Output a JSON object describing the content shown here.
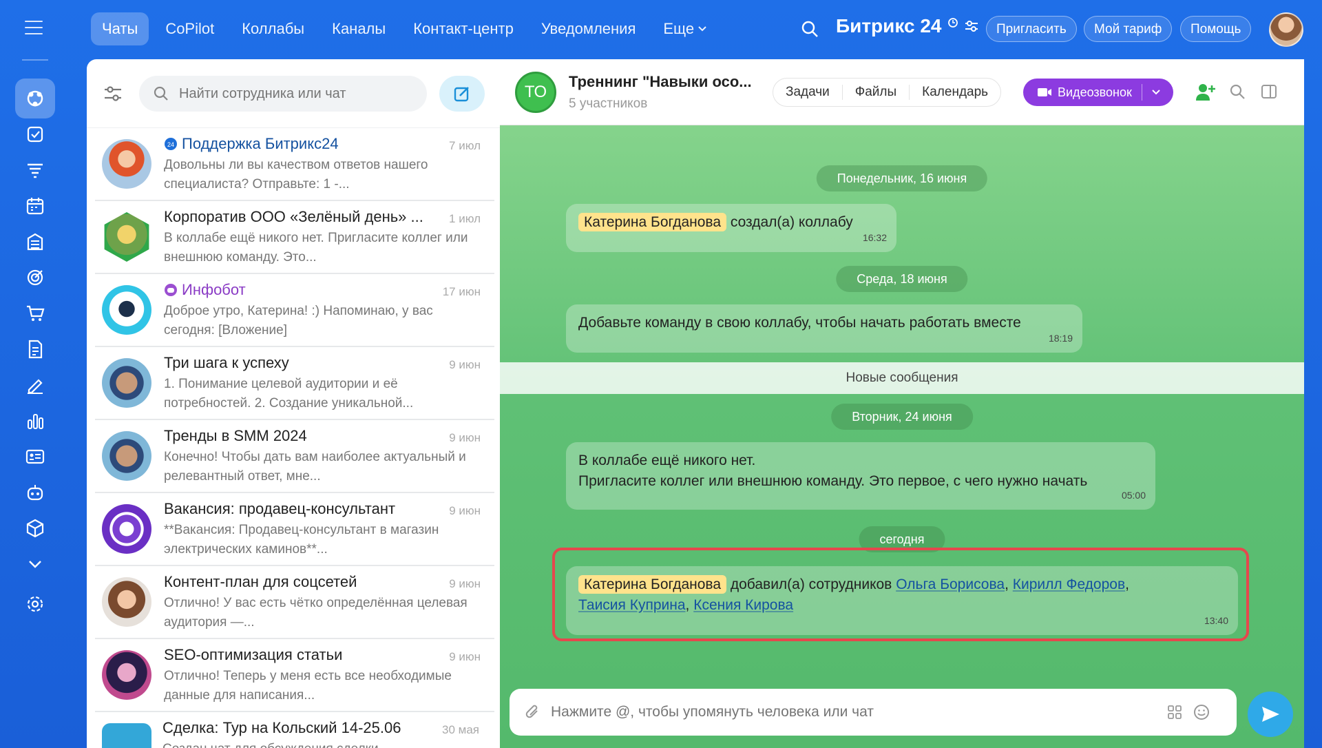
{
  "topnav": {
    "items": [
      "Чаты",
      "CoPilot",
      "Коллабы",
      "Каналы",
      "Контакт-центр",
      "Уведомления",
      "Еще"
    ],
    "brand": "Битрикс 24",
    "invite": "Пригласить",
    "tariff": "Мой тариф",
    "help": "Помощь"
  },
  "chatlist": {
    "search_placeholder": "Найти сотрудника или чат",
    "items": [
      {
        "name": "Поддержка Битрикс24",
        "date": "7 июл",
        "preview": "Довольны ли вы качеством ответов нашего специалиста? Отправьте: 1 -..."
      },
      {
        "name": "Корпоратив ООО «Зелёный день» ...",
        "date": "1 июл",
        "preview": "В коллабе ещё никого нет. Пригласите коллег или внешнюю команду. Это..."
      },
      {
        "name": "Инфобот",
        "date": "17 июн",
        "preview": "Доброе утро, Катерина! :) Напоминаю, у вас сегодня: [Вложение]"
      },
      {
        "name": "Три шага к успеху",
        "date": "9 июн",
        "preview": "1. Понимание целевой аудитории и её потребностей. 2. Создание уникальной..."
      },
      {
        "name": "Тренды в SMM 2024",
        "date": "9 июн",
        "preview": "Конечно! Чтобы дать вам наиболее актуальный и релевантный ответ, мне..."
      },
      {
        "name": "Вакансия: продавец-консультант",
        "date": "9 июн",
        "preview": "**Вакансия: Продавец-консультант в магазин электрических каминов**..."
      },
      {
        "name": "Контент-план для соцсетей",
        "date": "9 июн",
        "preview": "Отлично! У вас есть чётко определённая целевая аудитория —..."
      },
      {
        "name": "SEO-оптимизация статьи",
        "date": "9 июн",
        "preview": "Отлично! Теперь у меня есть все необходимые данные для написания..."
      },
      {
        "name": "Сделка: Тур на Кольский 14-25.06",
        "date": "30 мая",
        "preview": "Создан чат для обсуждения сделки"
      }
    ]
  },
  "chat": {
    "avatar_text": "ТО",
    "title": "Треннинг \"Навыки осо...",
    "subtitle": "5 участников",
    "tabs": [
      "Задачи",
      "Файлы",
      "Календарь"
    ],
    "video_label": "Видеозвонок",
    "dates": [
      "Понедельник, 16 июня",
      "Среда, 18 июня",
      "Вторник, 24 июня",
      "сегодня"
    ],
    "new_messages": "Новые сообщения",
    "msg1": {
      "author": "Катерина Богданова",
      "text": "создал(а) коллабу",
      "time": "16:32"
    },
    "msg2": {
      "text": "Добавьте команду в свою коллабу, чтобы начать работать вместе",
      "time": "18:19"
    },
    "msg3": {
      "line1": "В коллабе ещё никого нет.",
      "line2": "Пригласите коллег или внешнюю команду. Это первое, с чего нужно начать",
      "time": "05:00"
    },
    "msg4": {
      "author": "Катерина Богданова",
      "text": "добавил(а) сотрудников",
      "people": [
        "Ольга Борисова",
        "Кирилл Федоров",
        "Таисия Куприна",
        "Ксения Кирова"
      ],
      "sep": ",",
      "time": "13:40"
    },
    "input_placeholder": "Нажмите @, чтобы упомянуть человека или чат"
  },
  "colors": {
    "accent": "#1f6fe8",
    "video": "#8c3be0",
    "highlight": "#ffe38c",
    "chat_bg": "#5fc075",
    "red_frame": "#e5484d"
  }
}
